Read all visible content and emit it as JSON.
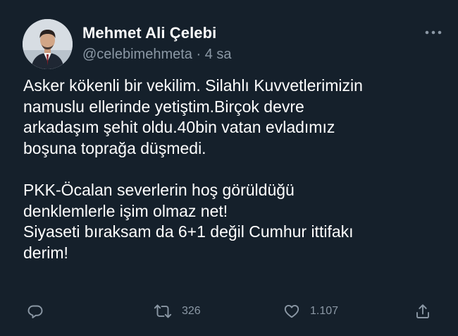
{
  "author": {
    "display_name": "Mehmet Ali Çelebi",
    "handle": "@celebimehmeta",
    "separator": "·",
    "time_ago": "4 sa"
  },
  "tweet": {
    "text": "Asker kökenli bir vekilim. Silahlı Kuvvetlerimizin\nnamuslu ellerinde yetiştim.Birçok devre\narkadaşım şehit oldu.40bin vatan evladımız\nboşuna toprağa düşmedi.\n\nPKK-Öcalan severlerin hoş görüldüğü\ndenklemlerle işim olmaz net!\nSiyaseti bıraksam da 6+1 değil Cumhur ittifakı\nderim!"
  },
  "actions": {
    "retweet_count": "326",
    "like_count": "1.107"
  },
  "icons": {
    "more": "more-dots-icon",
    "reply": "reply-bubble-icon",
    "retweet": "retweet-icon",
    "like": "heart-icon",
    "share": "share-icon"
  },
  "colors": {
    "background": "#15202b",
    "text_primary": "#ffffff",
    "text_secondary": "#8b98a5"
  }
}
